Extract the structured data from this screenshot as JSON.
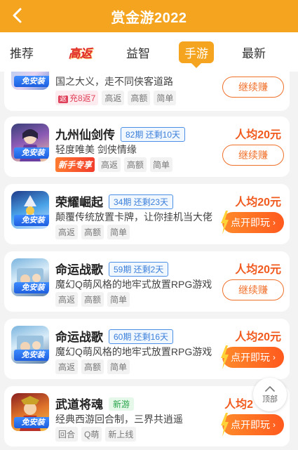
{
  "header": {
    "title": "赏金游2022"
  },
  "tabs": [
    {
      "label": "推荐"
    },
    {
      "label": "高返"
    },
    {
      "label": "益智"
    },
    {
      "label": "手游"
    },
    {
      "label": "最新"
    }
  ],
  "icon_badge": "免安装",
  "cards": [
    {
      "name": "",
      "desc": "国之大义，走不同侠客道路",
      "tags": [
        "充8返7",
        "高返",
        "高额",
        "简单"
      ],
      "tag_rebate_mark": "返",
      "button": "继续赚"
    },
    {
      "name": "九州仙剑传",
      "period": "82期  还剩10天",
      "desc": "轻度唯美 剑侠情缘",
      "tags": [
        "新手专享",
        "高返",
        "高额",
        "简单"
      ],
      "reward": "人均20元",
      "button": "继续赚"
    },
    {
      "name": "荣耀崛起",
      "period": "34期  还剩23天",
      "desc": "颠覆传统放置卡牌，让你挂机当大佬",
      "tags": [
        "高返",
        "高额",
        "简单"
      ],
      "reward": "人均20元",
      "button": "点开即玩"
    },
    {
      "name": "命运战歌",
      "period": "59期  还剩2天",
      "desc": "魔幻Q萌风格的地牢式放置RPG游戏",
      "tags": [
        "高返",
        "高额",
        "简单"
      ],
      "reward": "人均20元",
      "button": "继续赚"
    },
    {
      "name": "命运战歌",
      "period": "60期  还剩16天",
      "desc": "魔幻Q萌风格的地牢式放置RPG游戏",
      "tags": [
        "高返",
        "高额",
        "简单"
      ],
      "reward": "人均20元",
      "button": "点开即玩"
    },
    {
      "name": "武道将魂",
      "newgame": "新游",
      "desc": "经典西游回合制，三界共逍遥",
      "tags": [
        "回合",
        "Q萌",
        "新上线"
      ],
      "reward": "人均2",
      "button": "点开即玩"
    }
  ],
  "to_top": {
    "label": "顶部"
  },
  "colors": {
    "accent": "#f4a41e",
    "reward": "#f05a1e",
    "period": "#3a7fd9"
  }
}
